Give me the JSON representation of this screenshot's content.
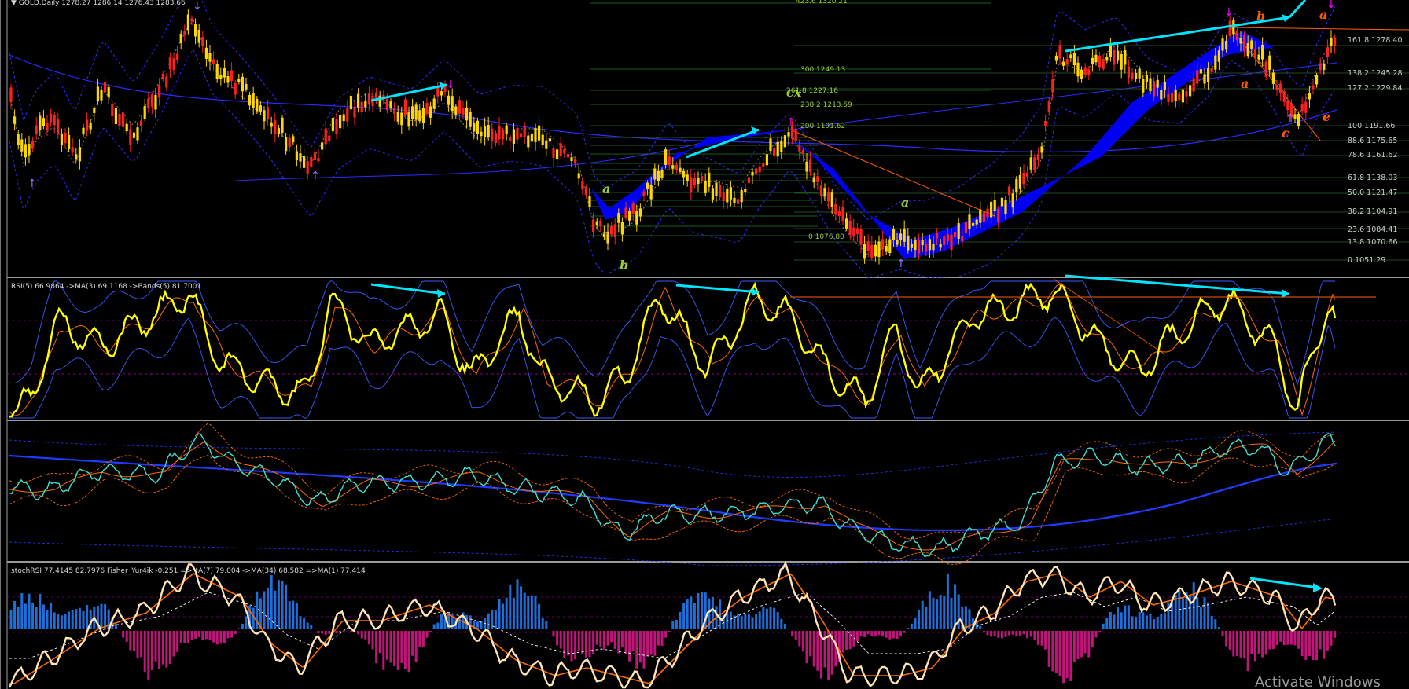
{
  "chart_data": [
    {
      "type": "candlestick",
      "panel": "price",
      "header": "GOLD,Daily  1278.27 1286.14 1276.43 1283.66",
      "symbol": "GOLD",
      "timeframe": "Daily",
      "ohlc_last": {
        "open": 1278.27,
        "high": 1286.14,
        "low": 1276.43,
        "close": 1283.66
      },
      "colors": {
        "up": "#ffd700",
        "down": "#ff2020",
        "bands": "#2b2bff",
        "arrows": "#00e5ff",
        "fill": "#0000ff"
      },
      "fib_levels_right": [
        {
          "pct": "161.8",
          "price": "1278.40"
        },
        {
          "pct": "138.2",
          "price": "1245.28"
        },
        {
          "pct": "127.2",
          "price": "1229.84"
        },
        {
          "pct": "100",
          "price": "1191.66"
        },
        {
          "pct": "88.6",
          "price": "1175.65"
        },
        {
          "pct": "78.6",
          "price": "1161.62"
        },
        {
          "pct": "61.8",
          "price": "1138.03"
        },
        {
          "pct": "50.0",
          "price": "1121.47"
        },
        {
          "pct": "38.2",
          "price": "1104.91"
        },
        {
          "pct": "23.6",
          "price": "1084.41"
        },
        {
          "pct": "13.8",
          "price": "1070.66"
        },
        {
          "pct": "0",
          "price": "1051.29"
        }
      ],
      "fib_levels_mid": [
        {
          "pct": "423.6",
          "price": "1320.21"
        },
        {
          "pct": "300",
          "price": "1249.13"
        },
        {
          "pct": "261.8",
          "price": "1227.16"
        },
        {
          "pct": "238.2",
          "price": "1213.59"
        },
        {
          "pct": "200",
          "price": "1191.62"
        },
        {
          "pct": "0",
          "price": "1076.80"
        }
      ],
      "wave_labels": [
        {
          "text": "a",
          "color": "#9acd32"
        },
        {
          "text": "b",
          "color": "#9acd32"
        },
        {
          "text": "cx",
          "color": "#9acd32"
        },
        {
          "text": "a",
          "color": "#9acd32"
        },
        {
          "text": "b",
          "color": "#ff5a00"
        },
        {
          "text": "a",
          "color": "#ff5a00"
        },
        {
          "text": "c",
          "color": "#ff5a00"
        },
        {
          "text": "e",
          "color": "#ff5a00"
        },
        {
          "text": "a",
          "color": "#ff5a00"
        }
      ]
    },
    {
      "type": "line",
      "panel": "rsi",
      "header": "RSI(5) 66.9864  ->MA(3) 69.1168  ->Bands(5) 81.7001",
      "series": [
        {
          "name": "RSI(5)",
          "last": 66.9864,
          "color": "#ffff00"
        },
        {
          "name": "MA(3)",
          "last": 69.1168,
          "color": "#ff6a00"
        },
        {
          "name": "Bands(5)",
          "last": 81.7001,
          "color": "#3a5aff"
        }
      ]
    },
    {
      "type": "line",
      "panel": "oscillator",
      "header": "",
      "series": [
        {
          "color": "#40e0d0"
        },
        {
          "color": "#ff6a00"
        },
        {
          "color": "#1e3cff"
        }
      ]
    },
    {
      "type": "bar",
      "panel": "stochrsi",
      "header": "stochRSI 77.4145 82.7976  Fisher_Yur4ik -0.251  =>MA(7) 79.004  ->MA(34) 68.582  =>MA(1) 77.414",
      "series": [
        {
          "name": "stochRSI",
          "last": 77.4145,
          "color": "#ffe4b5"
        },
        {
          "name": "Fisher_Yur4ik",
          "last": -0.251,
          "color": "#1e6fd9"
        },
        {
          "name": "MA(7)",
          "last": 79.004,
          "color": "#ff6a00"
        },
        {
          "name": "MA(34)",
          "last": 68.582,
          "color": "#ffffff"
        },
        {
          "name": "MA(1)",
          "last": 77.414,
          "color": "#ffe4b5"
        }
      ]
    }
  ],
  "watermark": "Activate Windows"
}
